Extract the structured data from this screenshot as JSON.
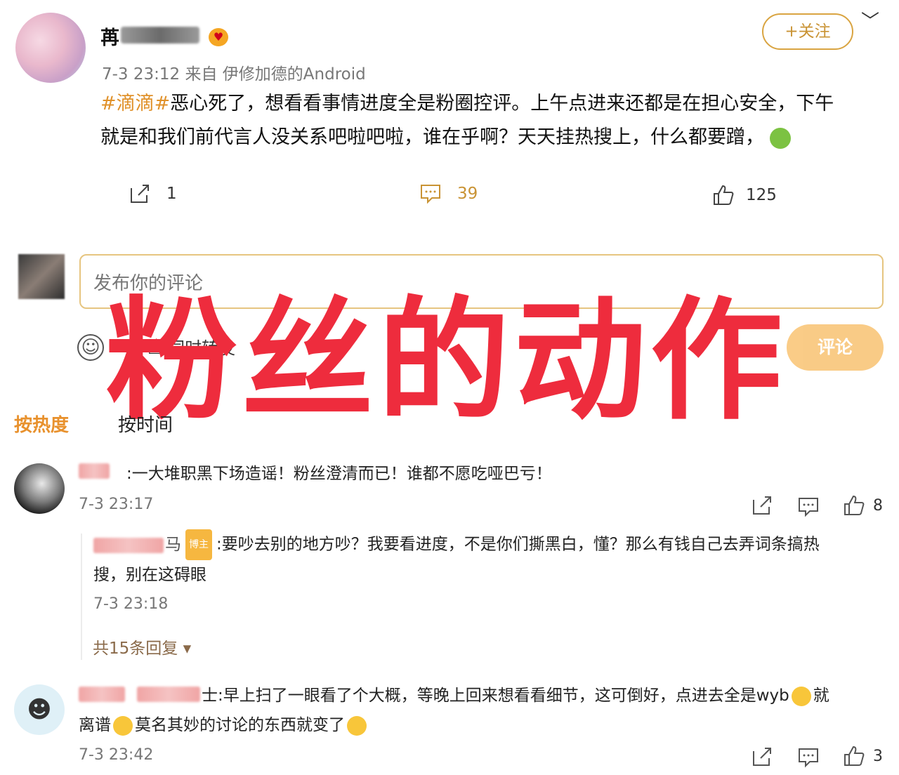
{
  "post": {
    "username": "苒",
    "badge_icon": "heart-face-icon",
    "meta": "7-3 23:12  来自  伊修加德的Android",
    "follow_label": "+关注",
    "hashtag": "#滴滴#",
    "text_line1": "恶心死了，想看看事情进度全是粉圈控评。上午点进来还都是在担心安全，下午",
    "text_line2": "就是和我们前代言人没关系吧啦吧啦，谁在乎啊？天天挂热搜上，什么都要蹭，",
    "actions": {
      "share_count": "1",
      "comment_count": "39",
      "like_count": "125"
    }
  },
  "composer": {
    "placeholder": "发布你的评论",
    "repost_label": "同时转发",
    "submit_label": "评论"
  },
  "overlay_text": "粉丝的动作",
  "sort_tabs": {
    "hot": "按热度",
    "time": "按时间"
  },
  "comments": [
    {
      "text": ":一大堆职黑下场造谣！粉丝澄清而已！谁都不愿吃哑巴亏！",
      "time": "7-3 23:17",
      "likes": "8",
      "reply": {
        "name_suffix": "马",
        "badge": "博主",
        "text_line1": ":要吵去别的地方吵？我要看进度，不是你们撕黑白，懂？那么有钱自己去弄词条搞热",
        "text_line2": "搜，别在这碍眼",
        "time": "7-3 23:18"
      },
      "more_replies": "共15条回复 ▾"
    },
    {
      "text_line1": "士:早上扫了一眼看了个大概，等晚上回来想看看细节，这可倒好，点进去全是wyb",
      "text_line1_end": "就",
      "text_line2_a": "离谱",
      "text_line2_b": "莫名其妙的讨论的东西就变了",
      "time": "7-3 23:42",
      "likes": "3"
    }
  ],
  "colors": {
    "accent": "#e8912d",
    "overlay": "#ee2c3d",
    "follow_border": "#d9a441"
  }
}
